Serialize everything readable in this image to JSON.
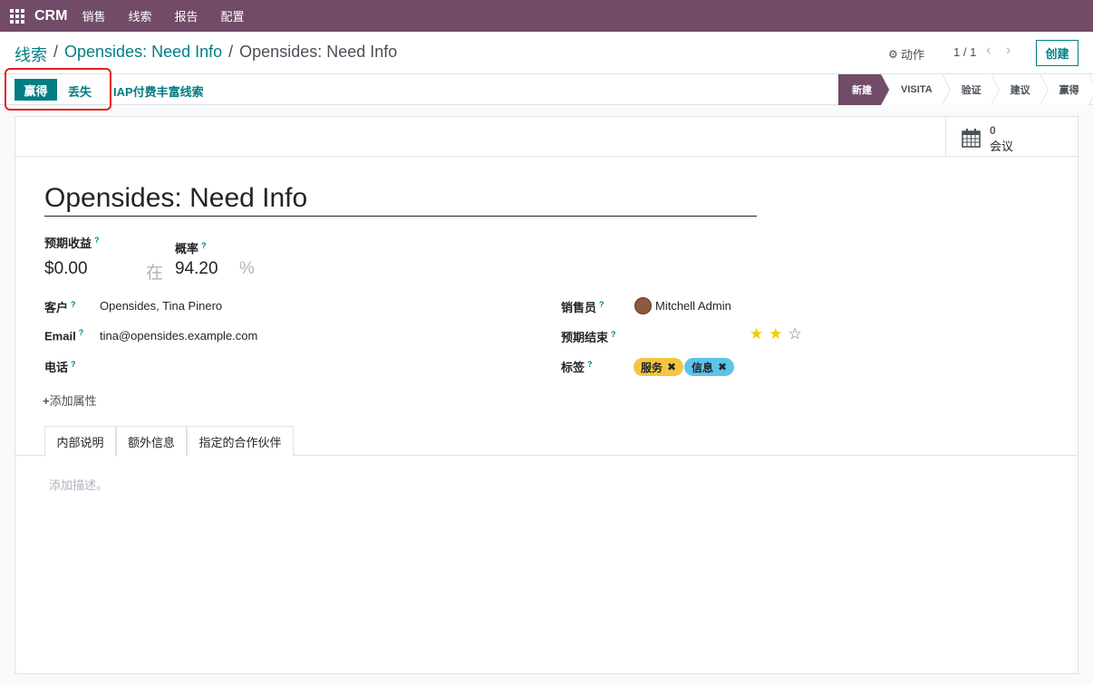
{
  "navbar": {
    "brand": "CRM",
    "menu": [
      "销售",
      "线索",
      "报告",
      "配置"
    ],
    "color": "#714b67"
  },
  "control": {
    "breadcrumb": [
      "线索",
      "Opensides: Need Info",
      "Opensides: Need Info"
    ],
    "actions_label": "动作",
    "pager": "1 / 1",
    "create_label": "创建"
  },
  "statusbar": {
    "won_label": "赢得",
    "lost_label": "丢失",
    "iap_label": "IAP付费丰富线索",
    "stages": [
      "新建",
      "VISITA",
      "验证",
      "建议",
      "赢得"
    ],
    "current_stage": "新建"
  },
  "sheet": {
    "meeting_count": "0",
    "meeting_label": "会议",
    "title": "Opensides: Need Info",
    "expected_revenue_label": "预期收益",
    "expected_revenue": "$0.00",
    "at_label": "在",
    "probability_label": "概率",
    "probability": "94.20",
    "percent": "%",
    "customer_label": "客户",
    "customer": "Opensides, Tina Pinero",
    "email_label": "Email",
    "email": "tina@opensides.example.com",
    "phone_label": "电话",
    "salesperson_label": "销售员",
    "salesperson": "Mitchell Admin",
    "expected_closing_label": "预期结束",
    "priority_stars": 2,
    "priority_max": 3,
    "tags_label": "标签",
    "tags": [
      "服务",
      "信息"
    ],
    "add_property": "添加属性",
    "tabs": [
      "内部说明",
      "额外信息",
      "指定的合作伙伴"
    ],
    "description_placeholder": "添加描述。"
  }
}
